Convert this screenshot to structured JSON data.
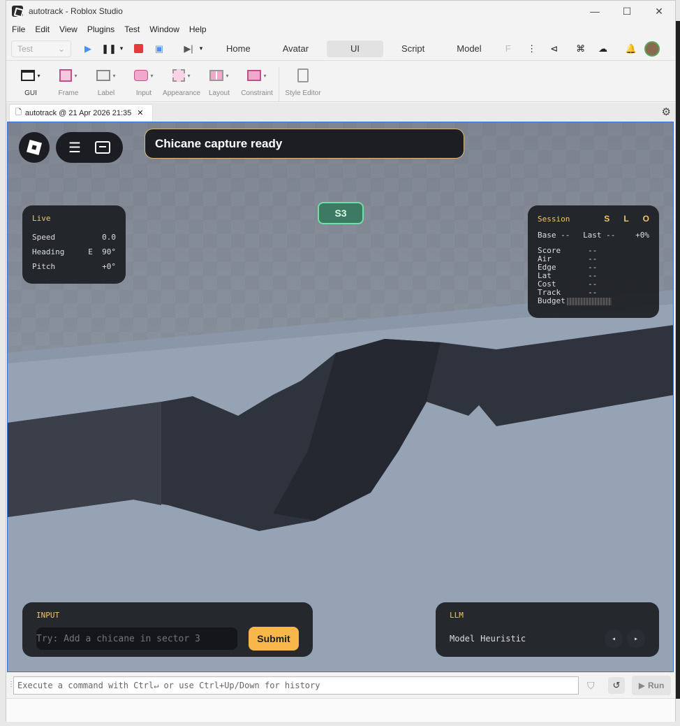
{
  "window": {
    "title": "autotrack - Roblox Studio"
  },
  "menu": [
    "File",
    "Edit",
    "View",
    "Plugins",
    "Test",
    "Window",
    "Help"
  ],
  "toolbar": {
    "mode": "Test",
    "tabs": [
      "Home",
      "Avatar",
      "UI",
      "Script",
      "Model",
      "F"
    ],
    "active_tab": "UI"
  },
  "ribbon": {
    "tools": [
      "GUI",
      "Frame",
      "Label",
      "Input",
      "Appearance",
      "Layout",
      "Constraint"
    ],
    "style_editor": "Style Editor"
  },
  "doc_tab": {
    "label": "autotrack @ 21 Apr 2026 21:35"
  },
  "game": {
    "banner": "Chicane capture ready",
    "sector_badge": "S3",
    "live": {
      "title": "Live",
      "rows": [
        {
          "label": "Speed",
          "value": "0.0"
        },
        {
          "label": "Heading",
          "value": "E  90°"
        },
        {
          "label": "Pitch",
          "value": "+0°"
        }
      ]
    },
    "session": {
      "title": "Session",
      "buttons": [
        "S",
        "L",
        "O"
      ],
      "base": "Base --",
      "last": "Last --",
      "delta": "+0%",
      "metrics": [
        {
          "label": "Score",
          "value": "--"
        },
        {
          "label": "Air",
          "value": "--"
        },
        {
          "label": "Edge",
          "value": "--"
        },
        {
          "label": "Lat",
          "value": "--"
        },
        {
          "label": "Cost",
          "value": "--"
        },
        {
          "label": "Track",
          "value": "--"
        }
      ],
      "budget_label": "Budget"
    },
    "input": {
      "title": "INPUT",
      "placeholder": "Try: Add a chicane in sector 3",
      "submit": "Submit"
    },
    "llm": {
      "title": "LLM",
      "model_label": "Model",
      "model_value": "Heuristic",
      "prev": "◂",
      "next": "▸"
    }
  },
  "command_bar": {
    "placeholder": "Execute a command with Ctrl↵ or use Ctrl+Up/Down for history",
    "run": "Run"
  },
  "colors": {
    "accent": "#3b6fd6",
    "submit": "#f9b64a",
    "badge": "#6ee0a3",
    "session_gold": "#f2c46d"
  }
}
